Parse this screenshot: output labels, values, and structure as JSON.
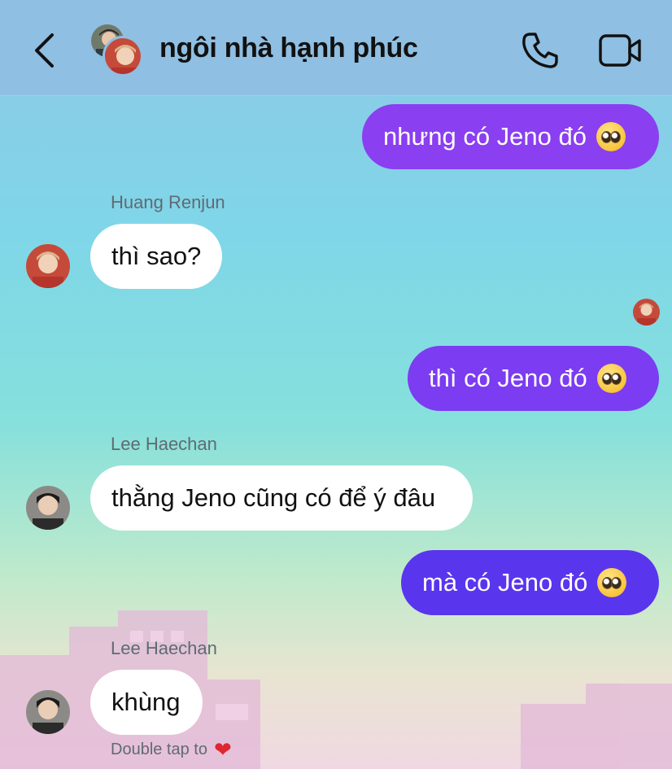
{
  "header": {
    "title": "ngôi nhà hạnh phúc"
  },
  "messages": [
    {
      "direction": "out",
      "text": "nhưng có Jeno đó",
      "emoji": "pleading-face"
    },
    {
      "direction": "in",
      "sender": "Huang Renjun",
      "text": "thì sao?"
    },
    {
      "direction": "out",
      "text": "thì có Jeno đó",
      "emoji": "pleading-face"
    },
    {
      "direction": "in",
      "sender": "Lee Haechan",
      "text": "thằng Jeno cũng có để ý đâu"
    },
    {
      "direction": "out",
      "text": "mà có Jeno đó",
      "emoji": "pleading-face"
    },
    {
      "direction": "in",
      "sender": "Lee Haechan",
      "text": "khùng"
    }
  ],
  "hint": {
    "text": "Double tap to",
    "icon": "heart-icon"
  },
  "colors": {
    "header_bg": "#8fbfe2",
    "bubble_out_1": "#8a3ff0",
    "bubble_out_2": "#7b3cf2",
    "bubble_out_3": "#5a35ee",
    "bubble_in": "#ffffff",
    "heart": "#e0262f"
  }
}
